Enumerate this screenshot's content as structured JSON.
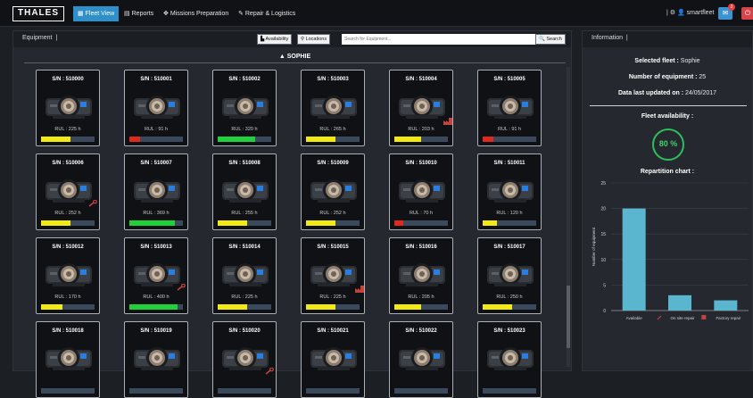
{
  "topbar": {
    "brand": "THALES",
    "nav": [
      {
        "label": "Fleet View",
        "icon": "▦",
        "active": true
      },
      {
        "label": "Reports",
        "icon": "▤",
        "active": false
      },
      {
        "label": "Missions Preparation",
        "icon": "✥",
        "active": false
      },
      {
        "label": "Repair & Logistics",
        "icon": "✎",
        "active": false
      }
    ],
    "username": "smartfleet",
    "notification_count": "2"
  },
  "equipment": {
    "title": "Equipment",
    "availability_btn": "Availability",
    "locations_btn": "Locations",
    "search_placeholder": "Search for Equipment...",
    "search_btn": "Search",
    "fleet_name": "SOPHIE",
    "cards": [
      {
        "sn": "S/N : 510000",
        "rul": "RUL : 225 h",
        "level": 0.55,
        "status": "yellow",
        "tool": null
      },
      {
        "sn": "S/N : 510001",
        "rul": "RUL : 91 h",
        "level": 0.2,
        "status": "red",
        "tool": null
      },
      {
        "sn": "S/N : 510002",
        "rul": "RUL : 320 h",
        "level": 0.7,
        "status": "green",
        "tool": null
      },
      {
        "sn": "S/N : 510003",
        "rul": "RUL : 265 h",
        "level": 0.55,
        "status": "yellow",
        "tool": null
      },
      {
        "sn": "S/N : 510004",
        "rul": "RUL : 203 h",
        "level": 0.5,
        "status": "yellow",
        "tool": "factory"
      },
      {
        "sn": "S/N : 510005",
        "rul": "RUL : 91 h",
        "level": 0.2,
        "status": "red",
        "tool": null
      },
      {
        "sn": "S/N : 510006",
        "rul": "RUL : 252 h",
        "level": 0.55,
        "status": "yellow",
        "tool": "onsite"
      },
      {
        "sn": "S/N : 510007",
        "rul": "RUL : 369 h",
        "level": 0.85,
        "status": "green",
        "tool": null
      },
      {
        "sn": "S/N : 510008",
        "rul": "RUL : 255 h",
        "level": 0.55,
        "status": "yellow",
        "tool": null
      },
      {
        "sn": "S/N : 510009",
        "rul": "RUL : 252 h",
        "level": 0.55,
        "status": "yellow",
        "tool": null
      },
      {
        "sn": "S/N : 510010",
        "rul": "RUL : 70 h",
        "level": 0.17,
        "status": "red",
        "tool": null
      },
      {
        "sn": "S/N : 510011",
        "rul": "RUL : 120 h",
        "level": 0.27,
        "status": "yellow",
        "tool": null
      },
      {
        "sn": "S/N : 510012",
        "rul": "RUL : 170 h",
        "level": 0.4,
        "status": "yellow",
        "tool": null
      },
      {
        "sn": "S/N : 510013",
        "rul": "RUL : 400 h",
        "level": 0.9,
        "status": "green",
        "tool": "onsite"
      },
      {
        "sn": "S/N : 510014",
        "rul": "RUL : 225 h",
        "level": 0.55,
        "status": "yellow",
        "tool": null
      },
      {
        "sn": "S/N : 510015",
        "rul": "RUL : 225 h",
        "level": 0.55,
        "status": "yellow",
        "tool": "factory"
      },
      {
        "sn": "S/N : 510016",
        "rul": "RUL : 205 h",
        "level": 0.5,
        "status": "yellow",
        "tool": null
      },
      {
        "sn": "S/N : 510017",
        "rul": "RUL : 250 h",
        "level": 0.55,
        "status": "yellow",
        "tool": null
      },
      {
        "sn": "S/N : 510018",
        "rul": "",
        "level": 0,
        "status": "yellow",
        "tool": null
      },
      {
        "sn": "S/N : 510019",
        "rul": "",
        "level": 0,
        "status": "yellow",
        "tool": null
      },
      {
        "sn": "S/N : 510020",
        "rul": "",
        "level": 0,
        "status": "yellow",
        "tool": "onsite"
      },
      {
        "sn": "S/N : 510021",
        "rul": "",
        "level": 0,
        "status": "yellow",
        "tool": null
      },
      {
        "sn": "S/N : 510022",
        "rul": "",
        "level": 0,
        "status": "yellow",
        "tool": null
      },
      {
        "sn": "S/N : 510023",
        "rul": "",
        "level": 0,
        "status": "yellow",
        "tool": null
      }
    ]
  },
  "colors": {
    "green": "#21d13a",
    "yellow": "#f2ea11",
    "red": "#e0291c",
    "accent": "#2f8fc8",
    "chart_bar": "#5ab5cf"
  },
  "info": {
    "title": "Information",
    "selected_label": "Selected fleet :",
    "selected_value": "Sophie",
    "count_label": "Number of equipment :",
    "count_value": "25",
    "updated_label": "Data last updated on :",
    "updated_value": "24/05/2017",
    "availability_title": "Fleet availability :",
    "availability_value": "80 %",
    "repartition_title": "Repartition chart :"
  },
  "chart_data": {
    "type": "bar",
    "categories": [
      "Available",
      "On site repair",
      "Factory repair"
    ],
    "values": [
      20,
      3,
      2
    ],
    "ylabel": "Number of equipment",
    "ylim": [
      0,
      25
    ],
    "yticks": [
      0,
      5,
      10,
      15,
      20,
      25
    ],
    "grid": true
  }
}
